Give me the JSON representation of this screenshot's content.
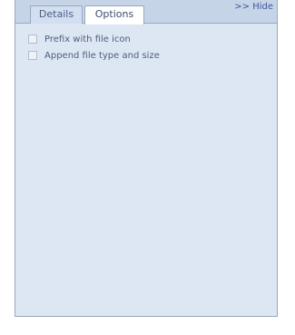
{
  "tabs": {
    "details_label": "Details",
    "options_label": "Options",
    "active": "Options"
  },
  "hide_link": ">> Hide",
  "options": {
    "items": [
      {
        "label": "Prefix with file icon",
        "checked": false
      },
      {
        "label": "Append file type and size",
        "checked": false
      }
    ]
  },
  "colors": {
    "panel_bg": "#dde6f3",
    "tabbar_bg": "#c6d4e8",
    "border": "#9aa8bd",
    "link": "#3b57a0"
  }
}
